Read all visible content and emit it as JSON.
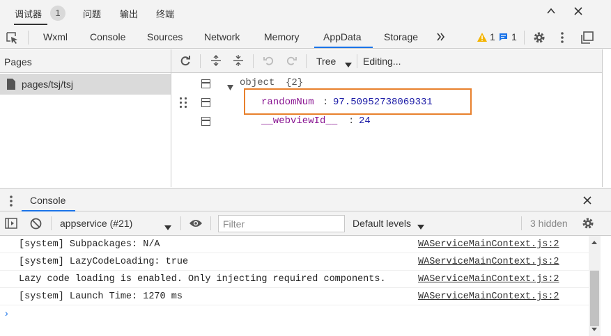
{
  "titlebar": {
    "tabs": [
      "调试器",
      "问题",
      "输出",
      "终端"
    ],
    "badge_count": "1",
    "minimize_icon": "chevron-up",
    "close_icon": "close"
  },
  "devtools_tabs": [
    "Wxml",
    "Console",
    "Sources",
    "Network",
    "Memory",
    "AppData",
    "Storage"
  ],
  "active_tab": "AppData",
  "status": {
    "warnings": "1",
    "messages": "1"
  },
  "pages_panel": {
    "title": "Pages",
    "items": [
      {
        "label": "pages/tsj/tsj"
      }
    ]
  },
  "appdata_toolbar": {
    "view_mode": "Tree",
    "editing_label": "Editing..."
  },
  "tree": {
    "root_label": "object",
    "root_count": "{2}",
    "entries": [
      {
        "key": "randomNum",
        "value": "97.50952738069331"
      },
      {
        "key": "__webviewId__",
        "value": "24"
      }
    ]
  },
  "console_panel": {
    "tab_label": "Console",
    "context_select": "appservice (#21)",
    "filter_placeholder": "Filter",
    "levels_label": "Default levels",
    "hidden_count": "3 hidden",
    "logs": [
      {
        "message": "[system] Subpackages: N/A",
        "source": "WAServiceMainContext.js:2"
      },
      {
        "message": "[system] LazyCodeLoading: true",
        "source": "WAServiceMainContext.js:2"
      },
      {
        "message": "Lazy code loading is enabled. Only injecting required components.",
        "source": "WAServiceMainContext.js:2"
      },
      {
        "message": "[system] Launch Time: 1270 ms",
        "source": "WAServiceMainContext.js:2"
      }
    ],
    "prompt": "›"
  },
  "colors": {
    "accent": "#1a73e8",
    "highlight_border": "#e8802c",
    "warning": "#f4b400",
    "key": "#881391",
    "value": "#1a1aa6"
  }
}
